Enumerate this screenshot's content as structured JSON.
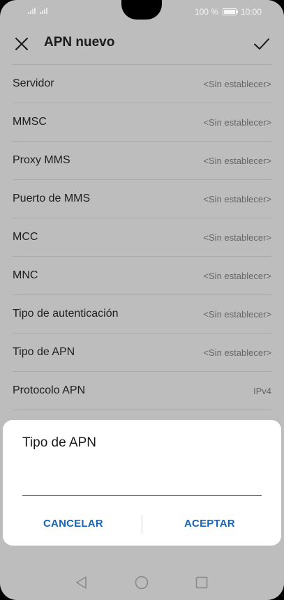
{
  "status_bar": {
    "battery": "100 %",
    "time": "10:00"
  },
  "header": {
    "title": "APN nuevo"
  },
  "settings": [
    {
      "label": "Servidor",
      "value": "<Sin establecer>"
    },
    {
      "label": "MMSC",
      "value": "<Sin establecer>"
    },
    {
      "label": "Proxy MMS",
      "value": "<Sin establecer>"
    },
    {
      "label": "Puerto de MMS",
      "value": "<Sin establecer>"
    },
    {
      "label": "MCC",
      "value": "<Sin establecer>"
    },
    {
      "label": "MNC",
      "value": "<Sin establecer>"
    },
    {
      "label": "Tipo de autenticación",
      "value": "<Sin establecer>"
    },
    {
      "label": "Tipo de APN",
      "value": "<Sin establecer>"
    },
    {
      "label": "Protocolo APN",
      "value": "IPv4"
    }
  ],
  "dialog": {
    "title": "Tipo de APN",
    "input_value": "",
    "cancel_label": "CANCELAR",
    "accept_label": "ACEPTAR"
  },
  "colors": {
    "accent": "#1565b8",
    "overlay_background": "#bdbdbd",
    "dialog_background": "#ffffff"
  },
  "icons": [
    "close-icon",
    "check-icon",
    "signal-icon",
    "battery-icon",
    "nav-back-icon",
    "nav-home-icon",
    "nav-recents-icon"
  ]
}
